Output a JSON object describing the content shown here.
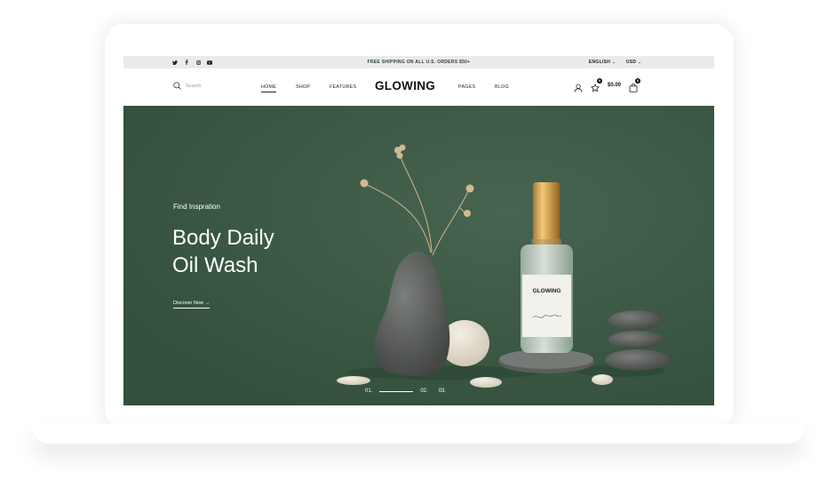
{
  "topbar": {
    "social_icons": [
      "twitter-icon",
      "facebook-icon",
      "instagram-icon",
      "youtube-icon"
    ],
    "promo": "FREE SHIPPING ON ALL U.S. ORDERS $50+",
    "language": "ENGLISH",
    "currency": "USD"
  },
  "nav": {
    "search_placeholder": "Search",
    "items": [
      {
        "label": "HOME",
        "active": true
      },
      {
        "label": "SHOP"
      },
      {
        "label": "FEATURES"
      },
      {
        "label": "PAGES"
      },
      {
        "label": "BLOG"
      }
    ],
    "logo": "GLOWING",
    "wishlist_count": "0",
    "cart_total": "$0.00",
    "cart_count": "0"
  },
  "hero": {
    "eyebrow": "Find Inspration",
    "title": "Body Daily\nOil Wash",
    "cta": "Discover Now →",
    "bottle_label": "GLOWING",
    "slides": [
      "01.",
      "02.",
      "03."
    ],
    "current_slide": 1
  },
  "colors": {
    "hero_bg": "#3a5642",
    "topbar_bg": "#e9ecea"
  }
}
